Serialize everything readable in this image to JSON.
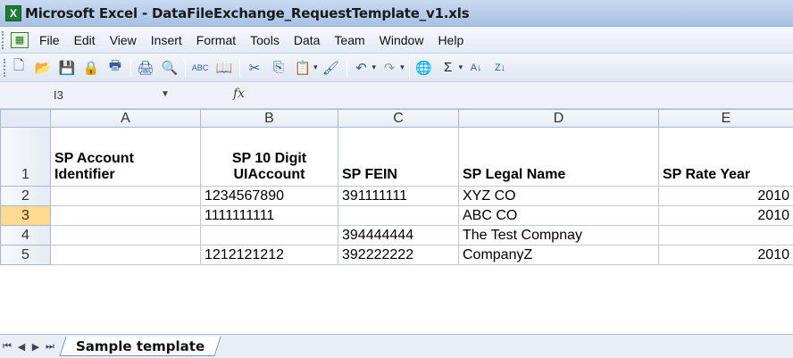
{
  "window": {
    "app_icon": "X",
    "title": "Microsoft Excel - DataFileExchange_RequestTemplate_v1.xls"
  },
  "menu": [
    "File",
    "Edit",
    "View",
    "Insert",
    "Format",
    "Tools",
    "Data",
    "Team",
    "Window",
    "Help"
  ],
  "toolbar": {
    "buttons": [
      {
        "icon": "new-icon",
        "glyph": "🗋"
      },
      {
        "icon": "open-icon",
        "glyph": "📂"
      },
      {
        "icon": "save-icon",
        "glyph": "💾"
      },
      {
        "icon": "permission-icon",
        "glyph": "🔒"
      },
      {
        "icon": "print-preview-icon",
        "glyph": "🖶"
      },
      {
        "icon": "print-icon",
        "glyph": "🖨"
      },
      {
        "icon": "preview-icon",
        "glyph": "🔍"
      },
      {
        "icon": "spelling-icon",
        "glyph": "ABC"
      },
      {
        "icon": "research-icon",
        "glyph": "📖"
      },
      {
        "icon": "cut-icon",
        "glyph": "✂"
      },
      {
        "icon": "copy-icon",
        "glyph": "⎘"
      },
      {
        "icon": "paste-icon",
        "glyph": "📋"
      },
      {
        "icon": "format-painter-icon",
        "glyph": "🖌"
      },
      {
        "icon": "undo-icon",
        "glyph": "↶"
      },
      {
        "icon": "redo-icon",
        "glyph": "↷"
      },
      {
        "icon": "hyperlink-icon",
        "glyph": "🌐"
      },
      {
        "icon": "autosum-icon",
        "glyph": "Σ"
      },
      {
        "icon": "sort-ascending-icon",
        "glyph": "A↓"
      },
      {
        "icon": "sort-descending-icon",
        "glyph": "Z↓"
      }
    ]
  },
  "formula_bar": {
    "name_box": "I3",
    "fx": "fx"
  },
  "grid": {
    "columns": [
      "A",
      "B",
      "C",
      "D",
      "E"
    ],
    "header_row": {
      "row_num": "1",
      "cells": [
        "SP Account Identifier",
        "SP 10 Digit UIAccount",
        "SP FEIN",
        "SP Legal Name",
        "SP Rate Year"
      ]
    },
    "rows": [
      {
        "row_num": "2",
        "cells": [
          "",
          "1234567890",
          "391111111",
          "XYZ CO",
          "2010"
        ]
      },
      {
        "row_num": "3",
        "cells": [
          "",
          "1111111111",
          "",
          "ABC CO",
          "2010"
        ]
      },
      {
        "row_num": "4",
        "cells": [
          "",
          "",
          "394444444",
          "The Test Compnay",
          ""
        ]
      },
      {
        "row_num": "5",
        "cells": [
          "",
          "1212121212",
          "392222222",
          "CompanyZ",
          "2010"
        ]
      }
    ]
  },
  "sheet_tabs": {
    "nav": [
      "⏮",
      "◀",
      "▶",
      "⏭"
    ],
    "active": "Sample template"
  }
}
